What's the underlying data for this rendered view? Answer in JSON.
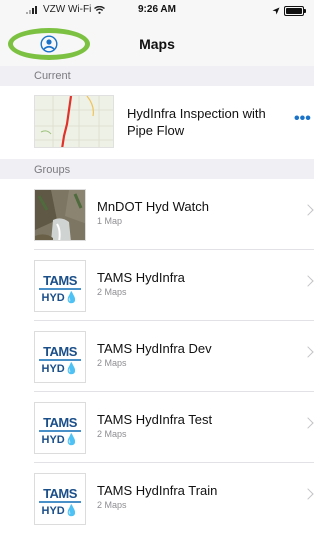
{
  "status_bar": {
    "carrier": "VZW Wi-Fi",
    "time": "9:26 AM"
  },
  "navbar": {
    "title": "Maps"
  },
  "sections": {
    "current": "Current",
    "groups": "Groups"
  },
  "current_map": {
    "title": "HydInfra Inspection with Pipe Flow",
    "more_label": "•••"
  },
  "groups": [
    {
      "title": "MnDOT Hyd Watch",
      "subtitle": "1 Map"
    },
    {
      "title": "TAMS HydInfra",
      "subtitle": "2 Maps",
      "logo_top": "TAMS",
      "logo_bottom": "HYD💧"
    },
    {
      "title": "TAMS HydInfra Dev",
      "subtitle": "2 Maps",
      "logo_top": "TAMS",
      "logo_bottom": "HYD💧"
    },
    {
      "title": "TAMS HydInfra Test",
      "subtitle": "2 Maps",
      "logo_top": "TAMS",
      "logo_bottom": "HYD💧"
    },
    {
      "title": "TAMS HydInfra Train",
      "subtitle": "2 Maps",
      "logo_top": "TAMS",
      "logo_bottom": "HYD💧"
    }
  ],
  "colors": {
    "accent": "#1a73c9",
    "highlight_ring": "#7cc142",
    "logo_blue": "#1b4f8a"
  }
}
